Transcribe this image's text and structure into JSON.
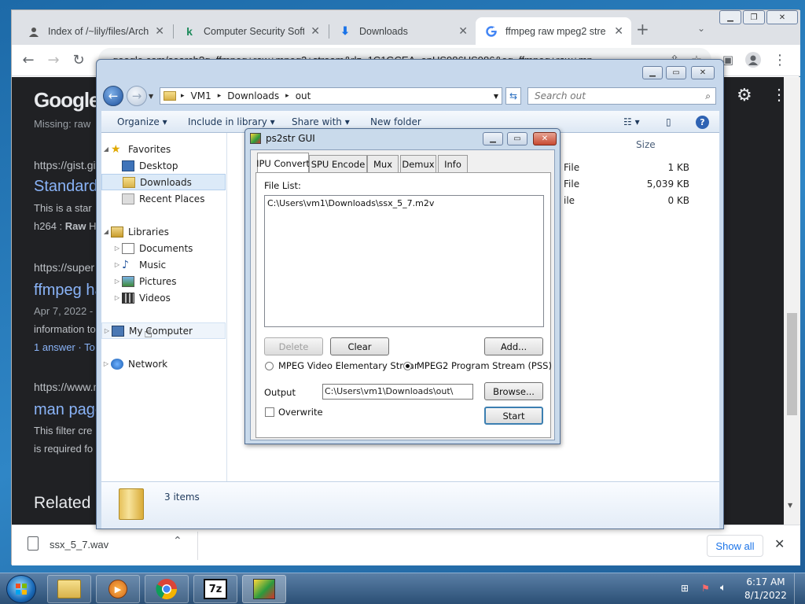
{
  "browser": {
    "tabs": [
      {
        "title": "Index of /~lily/files/Arch",
        "icon": "user-icon"
      },
      {
        "title": "Computer Security Softw",
        "icon": "kaspersky-k-icon"
      },
      {
        "title": "Downloads",
        "icon": "download-icon"
      },
      {
        "title": "ffmpeg raw mpeg2 stre",
        "icon": "google-g-icon",
        "active": true
      }
    ],
    "url": "google.com/search?q=ffmpeg+raw+mpeg2+stream&rlz=1C1GCEA_enUS986US986&oq=ffmpeg+raw+mp"
  },
  "google_page": {
    "logo": "Google",
    "snippet_missing": "Missing: raw",
    "url1": "https://gist.git",
    "title1": "Standard",
    "line1a": "This is a star",
    "line1b_pre": "h264 : ",
    "line1b_bold": "Raw",
    "line1b_post": " H",
    "url2": "https://super",
    "title2": "ffmpeg ha",
    "line2a": "Apr 7, 2022 -",
    "line2b": "information to",
    "line2c": "1 answer · To",
    "url3": "https://www.m",
    "title3": "man page",
    "line3a": "This filter cre",
    "line3b": "is required fo",
    "related": "Related"
  },
  "download_bar": {
    "file": "ssx_5_7.wav",
    "show_all": "Show all"
  },
  "explorer": {
    "breadcrumb": [
      "VM1",
      "Downloads",
      "out"
    ],
    "search_placeholder": "Search out",
    "commands": {
      "organize": "Organize",
      "include": "Include in library",
      "share": "Share with",
      "newfolder": "New folder"
    },
    "nav": {
      "favorites": "Favorites",
      "desktop": "Desktop",
      "downloads": "Downloads",
      "recent": "Recent Places",
      "libraries": "Libraries",
      "documents": "Documents",
      "music": "Music",
      "pictures": "Pictures",
      "videos": "Videos",
      "computer": "My Computer",
      "network": "Network"
    },
    "size_header": "Size",
    "files": [
      {
        "type": "File",
        "size": "1 KB"
      },
      {
        "type": "File",
        "size": "5,039 KB"
      },
      {
        "type": "ile",
        "size": "0 KB"
      }
    ],
    "status": "3 items"
  },
  "dialog": {
    "title": "ps2str GUI",
    "tabs": [
      "IPU Convert",
      "SPU Encode",
      "Mux",
      "Demux",
      "Info"
    ],
    "file_list_label": "File List:",
    "file_list": [
      "C:\\Users\\vm1\\Downloads\\ssx_5_7.m2v"
    ],
    "delete": "Delete",
    "clear": "Clear",
    "add": "Add...",
    "radio1": "MPEG Video Elementary Strear",
    "radio2": "MPEG2 Program Stream (PSS)",
    "output_label": "Output",
    "output_value": "C:\\Users\\vm1\\Downloads\\out\\",
    "browse": "Browse...",
    "overwrite": "Overwrite",
    "start": "Start"
  },
  "taskbar": {
    "time": "6:17 AM",
    "date": "8/1/2022",
    "apps": [
      "explorer-icon",
      "media-player-icon",
      "chrome-icon",
      "7zip-icon",
      "ps2str-icon"
    ]
  },
  "colors": {
    "google_dark_bg": "#202124",
    "google_link": "#8ab4f8",
    "chrome_tabbar": "#dee1e6",
    "explorer_frame": "#c7d8ec"
  }
}
